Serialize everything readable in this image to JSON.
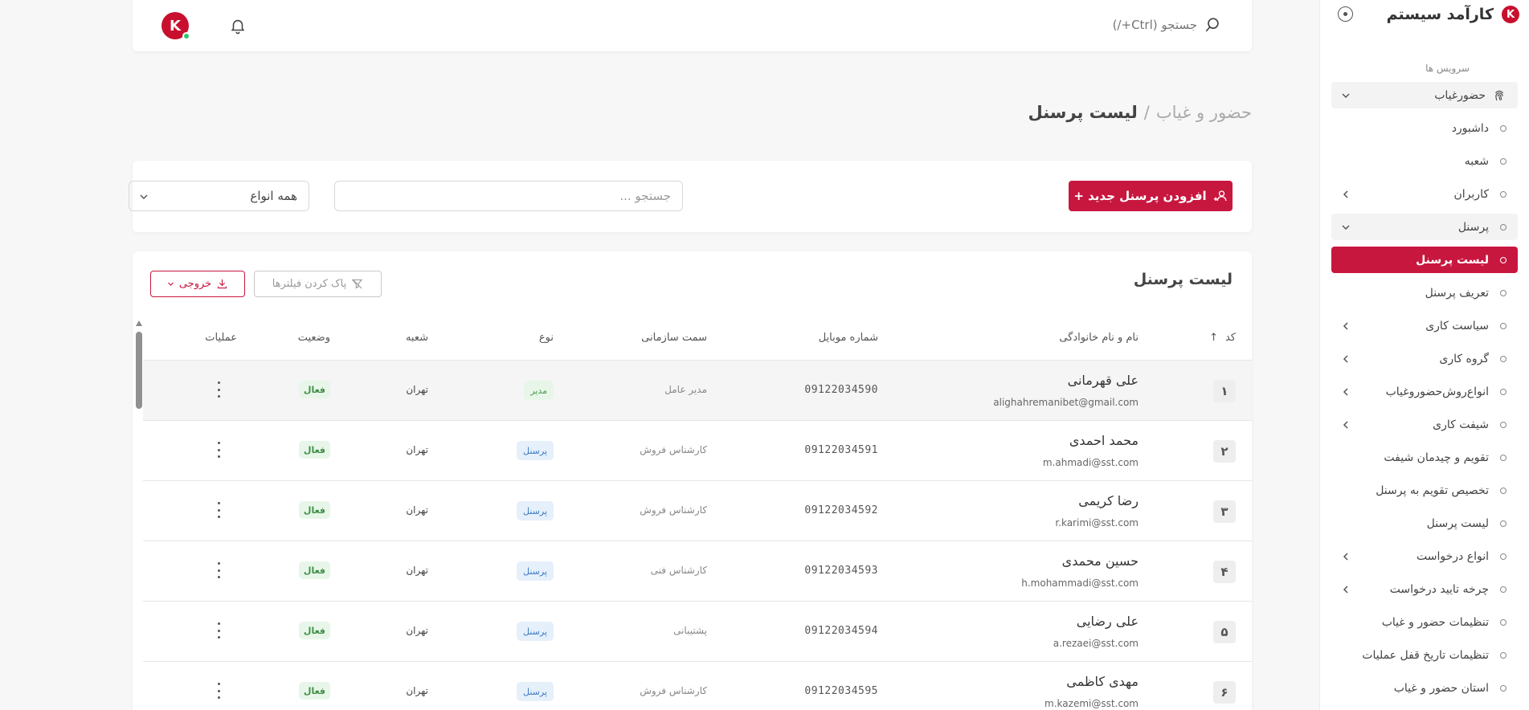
{
  "sidebar": {
    "brand_title": "کارآمد سیستم",
    "brand_logo_letter": "K",
    "section_label": "سرویس ها",
    "items": [
      {
        "label": "حضورغیاب",
        "kind": "parent",
        "expanded": true
      },
      {
        "label": "داشبورد",
        "kind": "child"
      },
      {
        "label": "شعبه",
        "kind": "child"
      },
      {
        "label": "کاربران",
        "kind": "child",
        "has_children": true
      },
      {
        "label": "پرسنل",
        "kind": "parent",
        "expanded": true
      },
      {
        "label": "لیست پرسنل",
        "kind": "active"
      },
      {
        "label": "تعریف پرسنل",
        "kind": "child"
      },
      {
        "label": "سیاست کاری",
        "kind": "child",
        "has_children": true
      },
      {
        "label": "گروه کاری",
        "kind": "child",
        "has_children": true
      },
      {
        "label": "انواع‌روش‌حضوروغیاب",
        "kind": "child",
        "has_children": true
      },
      {
        "label": "شیفت کاری",
        "kind": "child",
        "has_children": true
      },
      {
        "label": "تقویم و چیدمان شیفت",
        "kind": "child"
      },
      {
        "label": "تخصیص تقویم به پرسنل",
        "kind": "child"
      },
      {
        "label": "لیست پرسنل",
        "kind": "child"
      },
      {
        "label": "انواع درخواست",
        "kind": "child",
        "has_children": true
      },
      {
        "label": "چرخه تایید درخواست",
        "kind": "child",
        "has_children": true
      },
      {
        "label": "تنظیمات حضور و غیاب",
        "kind": "child"
      },
      {
        "label": "تنظیمات تاریخ قفل عملیات",
        "kind": "child"
      },
      {
        "label": "استان حضور و غیاب",
        "kind": "child"
      }
    ]
  },
  "topbar": {
    "search_placeholder": "جستجو (Ctrl+/)",
    "avatar_letter": "K"
  },
  "breadcrumb": {
    "parent": "حضور و غیاب",
    "separator": "/",
    "current": "لیست پرسنل"
  },
  "actions": {
    "add_button": "افزودن پرسنل جدید +",
    "search_placeholder": "جستجو ...",
    "type_filter_value": "همه انواع"
  },
  "table": {
    "title": "لیست پرسنل",
    "clear_filters": "پاک کردن فیلترها",
    "export": "خروجی",
    "headers": {
      "code": "کد",
      "sort_indicator": "↑",
      "name": "نام و نام خانوادگی",
      "mobile": "شماره موبایل",
      "position": "سمت سازمانی",
      "type": "نوع",
      "branch": "شعبه",
      "status": "وضعیت",
      "actions": "عملیات"
    },
    "rows": [
      {
        "code": "۱",
        "name": "علی قهرمانی",
        "email": "alighahremanibet@gmail.com",
        "mobile": "09122034590",
        "position": "مدیر عامل",
        "type": "مدیر",
        "type_kind": "manager",
        "branch": "تهران",
        "status": "فعال"
      },
      {
        "code": "۲",
        "name": "محمد احمدی",
        "email": "m.ahmadi@sst.com",
        "mobile": "09122034591",
        "position": "کارشناس فروش",
        "type": "پرسنل",
        "type_kind": "staff",
        "branch": "تهران",
        "status": "فعال"
      },
      {
        "code": "۳",
        "name": "رضا کریمی",
        "email": "r.karimi@sst.com",
        "mobile": "09122034592",
        "position": "کارشناس فروش",
        "type": "پرسنل",
        "type_kind": "staff",
        "branch": "تهران",
        "status": "فعال"
      },
      {
        "code": "۴",
        "name": "حسین محمدی",
        "email": "h.mohammadi@sst.com",
        "mobile": "09122034593",
        "position": "کارشناس فنی",
        "type": "پرسنل",
        "type_kind": "staff",
        "branch": "تهران",
        "status": "فعال"
      },
      {
        "code": "۵",
        "name": "علی رضایی",
        "email": "a.rezaei@sst.com",
        "mobile": "09122034594",
        "position": "پشتیبانی",
        "type": "پرسنل",
        "type_kind": "staff",
        "branch": "تهران",
        "status": "فعال"
      },
      {
        "code": "۶",
        "name": "مهدی کاظمی",
        "email": "m.kazemi@sst.com",
        "mobile": "09122034595",
        "position": "کارشناس فروش",
        "type": "پرسنل",
        "type_kind": "staff",
        "branch": "تهران",
        "status": "فعال"
      }
    ]
  },
  "colors": {
    "accent": "#c8173f",
    "status_active_bg": "#e8f6e9",
    "type_staff_bg": "#e6f0fb"
  },
  "icons": [
    "fingerprint-icon",
    "search-icon",
    "bell-icon",
    "user-plus-icon",
    "filter-off-icon",
    "download-icon",
    "chevron-down-icon",
    "chevron-left-icon",
    "kebab-icon"
  ]
}
